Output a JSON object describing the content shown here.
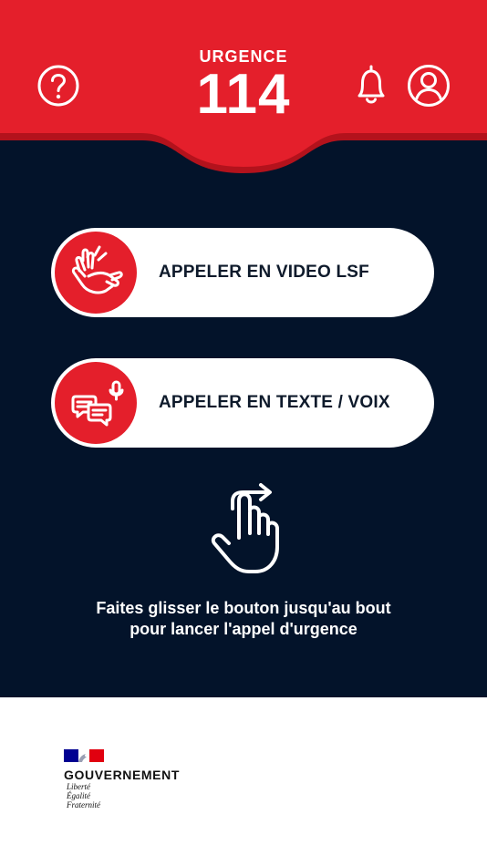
{
  "header": {
    "title_small": "URGENCE",
    "title_number": "114",
    "help_icon": "help-circle-icon",
    "notification_icon": "bell-icon",
    "account_icon": "user-circle-icon"
  },
  "actions": [
    {
      "label": "APPELER EN VIDEO LSF",
      "icon": "sign-language-hands-icon"
    },
    {
      "label": "APPELER EN TEXTE / VOIX",
      "icon": "chat-microphone-icon"
    }
  ],
  "hint": {
    "icon": "swipe-right-hand-icon",
    "line1": "Faites glisser le bouton jusqu'au bout",
    "line2": "pour lancer l'appel d'urgence"
  },
  "footer": {
    "gov_name": "GOUVERNEMENT",
    "motto": [
      "Liberté",
      "Égalité",
      "Fraternité"
    ]
  },
  "colors": {
    "primary_red": "#E41F2B",
    "dark_background": "#03132A",
    "white": "#FFFFFF",
    "flag_blue": "#000091",
    "flag_red": "#E1000F"
  }
}
